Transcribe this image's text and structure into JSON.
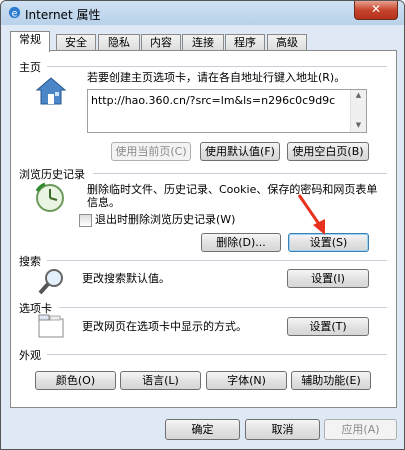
{
  "window": {
    "title": "Internet 属性",
    "close_glyph": "✕"
  },
  "tabs": [
    "常规",
    "安全",
    "隐私",
    "内容",
    "连接",
    "程序",
    "高级"
  ],
  "home": {
    "section_label": "主页",
    "instruction": "若要创建主页选项卡，请在各自地址行键入地址(R)。",
    "url": "http://hao.360.cn/?src=lm&ls=n296c0c9d9c",
    "buttons": {
      "use_current": "使用当前页(C)",
      "use_default": "使用默认值(F)",
      "use_blank": "使用空白页(B)"
    }
  },
  "history": {
    "section_label": "浏览历史记录",
    "description_line1": "删除临时文件、历史记录、Cookie、保存的密码和网页表单",
    "description_line2": "信息。",
    "checkbox_label": "退出时删除浏览历史记录(W)",
    "checkbox_checked": false,
    "delete_button": "删除(D)...",
    "settings_button": "设置(S)"
  },
  "search": {
    "section_label": "搜索",
    "description": "更改搜索默认值。",
    "settings_button": "设置(I)"
  },
  "tabs_section": {
    "section_label": "选项卡",
    "description": "更改网页在选项卡中显示的方式。",
    "settings_button": "设置(T)"
  },
  "appearance": {
    "section_label": "外观",
    "buttons": [
      "颜色(O)",
      "语言(L)",
      "字体(N)",
      "辅助功能(E)"
    ]
  },
  "footer": {
    "ok": "确定",
    "cancel": "取消",
    "apply": "应用(A)"
  },
  "colors": {
    "annotation_arrow": "#e8321e",
    "title_gradient_top": "#cfe1f3",
    "panel_bg": "#ffffff"
  },
  "icons": [
    "internet-explorer-icon",
    "house-icon",
    "history-clock-icon",
    "magnifier-icon",
    "tabbed-pages-icon",
    "red-arrow"
  ]
}
